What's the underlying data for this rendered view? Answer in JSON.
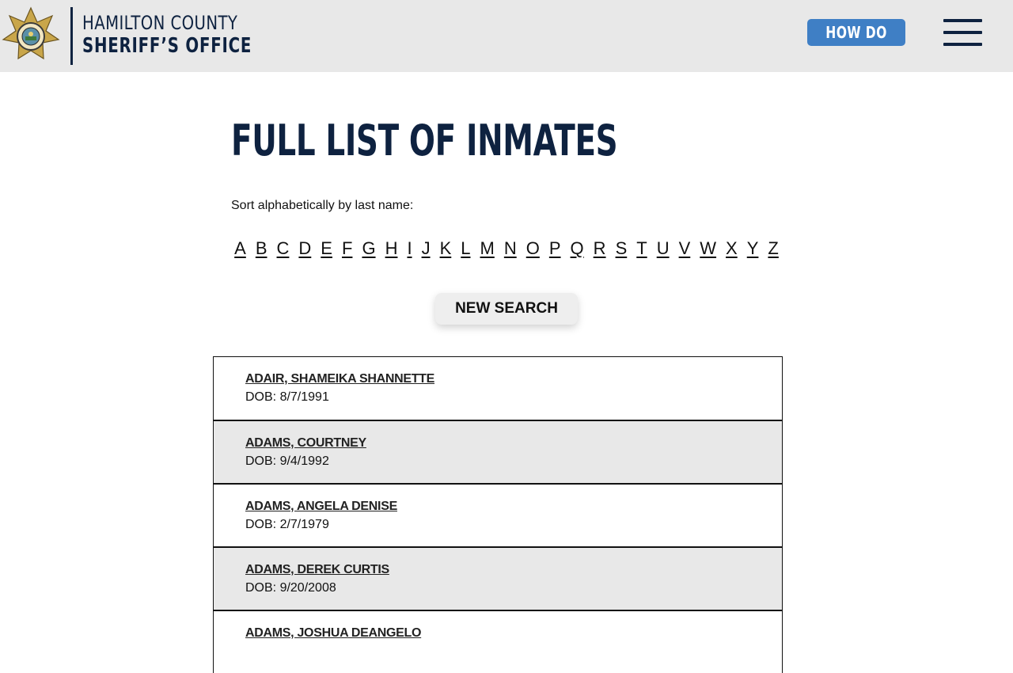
{
  "header": {
    "logo_line1": "HAMILTON COUNTY",
    "logo_line2": "SHERIFF’S OFFICE",
    "how_do_i_label": "HOW DO I...?",
    "badge_icon": "sheriff-star-badge",
    "menu_icon": "hamburger-menu-icon"
  },
  "main": {
    "title": "FULL LIST OF INMATES",
    "sort_label": "Sort alphabetically by last name:",
    "letters": [
      "A",
      "B",
      "C",
      "D",
      "E",
      "F",
      "G",
      "H",
      "I",
      "J",
      "K",
      "L",
      "M",
      "N",
      "O",
      "P",
      "Q",
      "R",
      "S",
      "T",
      "U",
      "V",
      "W",
      "X",
      "Y",
      "Z"
    ],
    "new_search_label": "NEW SEARCH"
  },
  "inmates": [
    {
      "name": "ADAIR, SHAMEIKA SHANNETTE",
      "dob": "DOB: 8/7/1991"
    },
    {
      "name": "ADAMS, COURTNEY",
      "dob": "DOB: 9/4/1992"
    },
    {
      "name": "ADAMS, ANGELA DENISE",
      "dob": "DOB: 2/7/1979"
    },
    {
      "name": "ADAMS, DEREK CURTIS",
      "dob": "DOB: 9/20/2008"
    },
    {
      "name": "ADAMS, JOSHUA DEANGELO",
      "dob": ""
    }
  ],
  "colors": {
    "header_bg": "#e8e8e8",
    "navy": "#0e2240",
    "button_blue": "#3f7fc5",
    "row_alt": "#e8e8e8"
  }
}
